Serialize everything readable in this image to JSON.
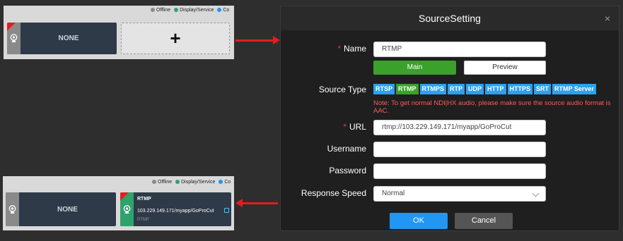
{
  "legend": [
    {
      "label": "Offline",
      "color": "#8a8a8a"
    },
    {
      "label": "Display/Service",
      "color": "#2ea36b"
    },
    {
      "label": "Co",
      "color": "#2196f3"
    }
  ],
  "top_panel": {
    "tile_label": "NONE",
    "add_symbol": "+"
  },
  "bottom_panel": {
    "tile_label": "NONE",
    "rtmp_tile": {
      "name": "RTMP",
      "url": "103.229.149.171/myapp/GoProCut",
      "type": "RTMP"
    }
  },
  "dialog": {
    "title": "SourceSetting",
    "close": "×",
    "name_label": "Name",
    "name_value": "RTMP",
    "main_button": "Main",
    "preview_button": "Preview",
    "source_type_label": "Source Type",
    "source_types": [
      "RTSP",
      "RTMP",
      "RTMPS",
      "RTP",
      "UDP",
      "HTTP",
      "HTTPS",
      "SRT",
      "RTMP Server"
    ],
    "active_source_type": "RTMP",
    "note": "Note: To get normal NDI|HX audio, please make sure the source audio format is AAC.",
    "url_label": "URL",
    "url_value": "rtmp://103.229.149.171/myapp/GoProCut",
    "username_label": "Username",
    "username_value": "",
    "password_label": "Password",
    "password_value": "",
    "speed_label": "Response Speed",
    "speed_value": "Normal",
    "ok_button": "OK",
    "cancel_button": "Cancel",
    "required_mark": "*"
  },
  "colors": {
    "accent_green": "#3aa12a",
    "accent_blue": "#2196f3",
    "note_red": "#ff5a5a",
    "arrow_red": "#e01e1e"
  }
}
